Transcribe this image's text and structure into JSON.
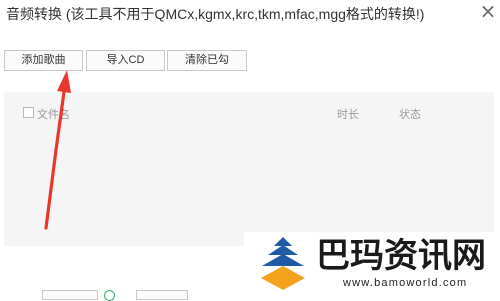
{
  "window": {
    "title": "音频转换 (该工具不用于QMCx,kgmx,krc,tkm,mfac,mgg格式的转换!)",
    "close_glyph": "×"
  },
  "toolbar": {
    "add_song_label": "添加歌曲",
    "import_cd_label": "导入CD",
    "clear_checked_label": "清除已勾"
  },
  "list": {
    "columns": {
      "filename": "文件名",
      "duration": "时长",
      "status": "状态"
    },
    "select_all_checked": false
  },
  "annotation": {
    "arrow_color": "#e8372c"
  },
  "watermark": {
    "text": "巴玛资讯网",
    "url": "www.bamoworld.com",
    "logo_colors": [
      "#1f5aa6",
      "#f2a21c"
    ]
  }
}
